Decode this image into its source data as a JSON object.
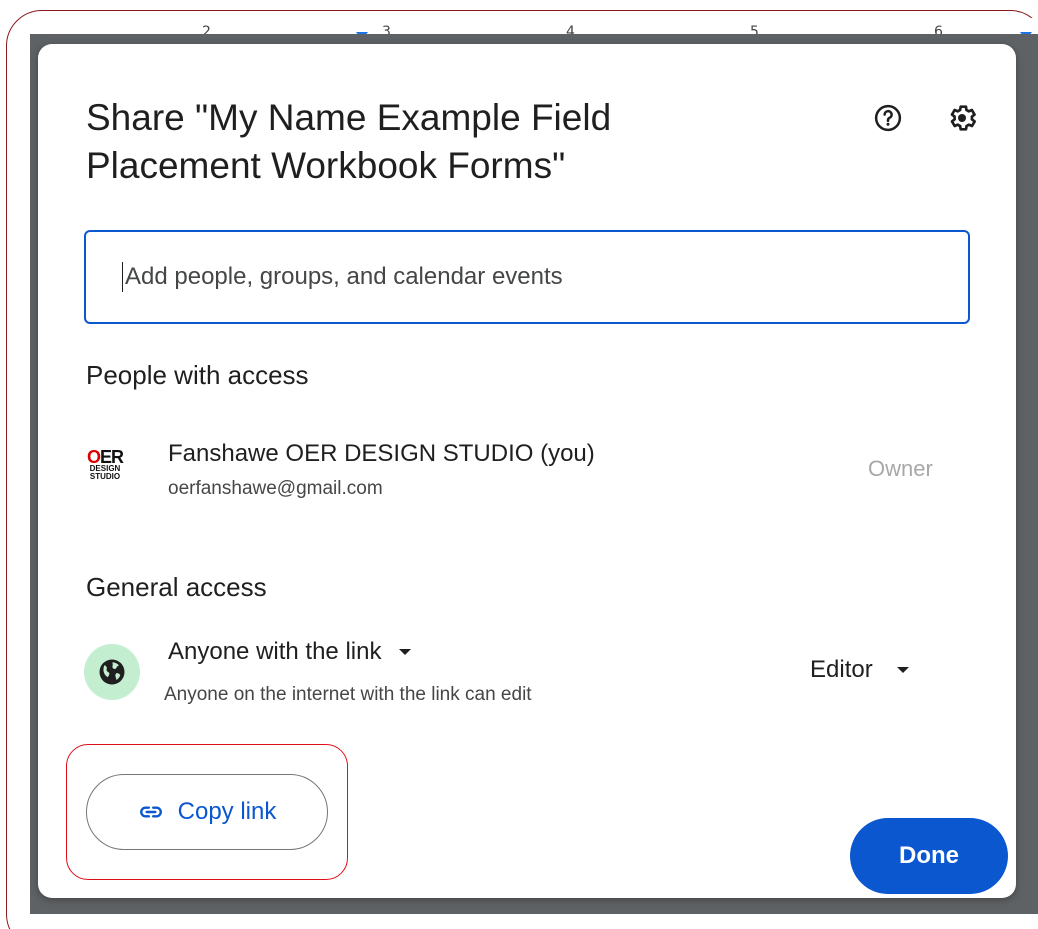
{
  "ruler": {
    "numbers": [
      "2",
      "3",
      "4",
      "5",
      "6"
    ]
  },
  "dialog": {
    "title": "Share \"My Name Example Field Placement Workbook Forms\"",
    "help_icon": "help-circle-icon",
    "settings_icon": "gear-icon"
  },
  "search": {
    "placeholder": "Add people, groups, and calendar events",
    "value": ""
  },
  "people_section": {
    "heading": "People with access",
    "people": [
      {
        "name": "Fanshawe OER DESIGN STUDIO (you)",
        "email": "oerfanshawe@gmail.com",
        "role": "Owner",
        "avatar_text": "OER",
        "avatar_sub1": "DESIGN",
        "avatar_sub2": "STUDIO"
      }
    ]
  },
  "general_access": {
    "heading": "General access",
    "scope": "Anyone with the link",
    "description": "Anyone on the internet with the link can edit",
    "role": "Editor",
    "icon": "globe-icon"
  },
  "actions": {
    "copy_link": "Copy link",
    "done": "Done",
    "link_icon": "link-icon"
  },
  "colors": {
    "accent": "#0b57d0",
    "globe_bg": "#c4eed0",
    "highlight": "#e0101a"
  }
}
